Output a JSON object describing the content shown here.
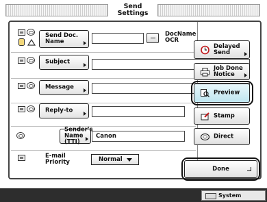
{
  "header": {
    "title": "Send\nSettings"
  },
  "rows": {
    "send_doc": {
      "button": "Send Doc.\nName",
      "docname_label": "DocName\nOCR",
      "value": ""
    },
    "subject": {
      "button": "Subject",
      "value": ""
    },
    "message": {
      "button": "Message",
      "value": ""
    },
    "reply_to": {
      "button": "Reply-to",
      "value": ""
    },
    "senders_name": {
      "button": "Sender's\nName (TTI)",
      "value": "Canon"
    },
    "email_priority": {
      "label": "E-mail\nPriority",
      "selected": "Normal"
    }
  },
  "side": {
    "delayed_send": "Delayed\nSend",
    "job_done_notice": "Job Done\nNotice",
    "preview": "Preview",
    "stamp": "Stamp",
    "direct": "Direct"
  },
  "done": "Done",
  "status_bar": {
    "system_monitor": "System Monitor"
  },
  "colors": {
    "preview_accent": "#bfe6f0",
    "frame": "#444444",
    "status_bar": "#2d2d2d"
  }
}
